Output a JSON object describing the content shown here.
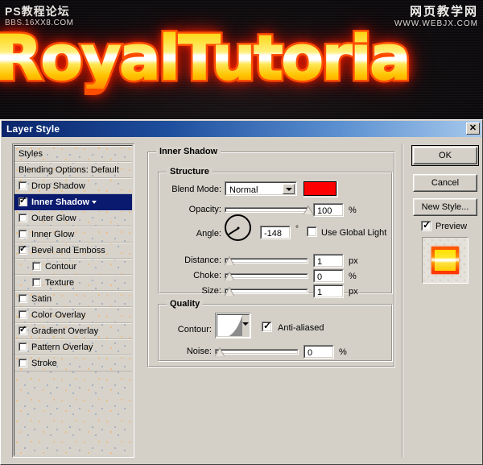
{
  "banner": {
    "watermark_left": {
      "line1": "PS教程论坛",
      "line2": "BBS.16XX8.COM"
    },
    "watermark_right": {
      "line1": "网页教学网",
      "line2": "WWW.WEBJX.COM"
    },
    "hero_text": "RoyalTutoria",
    "colors": {
      "background": "#0d0a0c",
      "glow": "#ff4400",
      "fill_top": "#ffd000",
      "fill_highlight": "#ffffff"
    }
  },
  "dialog": {
    "title": "Layer Style",
    "close_label": "✕",
    "titlebar_color_left": "#0a246a",
    "titlebar_color_right": "#a6c8ec",
    "face_color": "#d4d0c8"
  },
  "styles_panel": {
    "header": "Styles",
    "blending_options": "Blending Options: Default",
    "items": [
      {
        "label": "Drop Shadow",
        "checked": false,
        "selected": false,
        "indent": false,
        "caret": false
      },
      {
        "label": "Inner Shadow",
        "checked": true,
        "selected": true,
        "indent": false,
        "caret": true
      },
      {
        "label": "Outer Glow",
        "checked": false,
        "selected": false,
        "indent": false,
        "caret": false
      },
      {
        "label": "Inner Glow",
        "checked": false,
        "selected": false,
        "indent": false,
        "caret": false
      },
      {
        "label": "Bevel and Emboss",
        "checked": true,
        "selected": false,
        "indent": false,
        "caret": false
      },
      {
        "label": "Contour",
        "checked": false,
        "selected": false,
        "indent": true,
        "caret": false
      },
      {
        "label": "Texture",
        "checked": false,
        "selected": false,
        "indent": true,
        "caret": false
      },
      {
        "label": "Satin",
        "checked": false,
        "selected": false,
        "indent": false,
        "caret": false
      },
      {
        "label": "Color Overlay",
        "checked": false,
        "selected": false,
        "indent": false,
        "caret": false
      },
      {
        "label": "Gradient Overlay",
        "checked": true,
        "selected": false,
        "indent": false,
        "caret": false
      },
      {
        "label": "Pattern Overlay",
        "checked": false,
        "selected": false,
        "indent": false,
        "caret": false
      },
      {
        "label": "Stroke",
        "checked": false,
        "selected": false,
        "indent": false,
        "caret": false
      }
    ]
  },
  "main_panel": {
    "group_title": "Inner Shadow",
    "structure": {
      "title": "Structure",
      "blend_mode_label": "Blend Mode:",
      "blend_mode_value": "Normal",
      "shadow_color": "#ff0000",
      "opacity_label": "Opacity:",
      "opacity_value": "100",
      "opacity_unit": "%",
      "opacity_percent": 100,
      "angle_label": "Angle:",
      "angle_value": "-148",
      "angle_unit": "°",
      "angle_degrees": -148,
      "use_global_light_label": "Use Global Light",
      "use_global_light_checked": false,
      "distance_label": "Distance:",
      "distance_value": "1",
      "distance_unit": "px",
      "distance_percent": 1,
      "choke_label": "Choke:",
      "choke_value": "0",
      "choke_unit": "%",
      "choke_percent": 0,
      "size_label": "Size:",
      "size_value": "1",
      "size_unit": "px",
      "size_percent": 1
    },
    "quality": {
      "title": "Quality",
      "contour_label": "Contour:",
      "anti_aliased_label": "Anti-aliased",
      "anti_aliased_checked": true,
      "noise_label": "Noise:",
      "noise_value": "0",
      "noise_unit": "%",
      "noise_percent": 0
    }
  },
  "right_panel": {
    "ok_label": "OK",
    "cancel_label": "Cancel",
    "new_style_label": "New Style...",
    "preview_label": "Preview",
    "preview_checked": true
  }
}
